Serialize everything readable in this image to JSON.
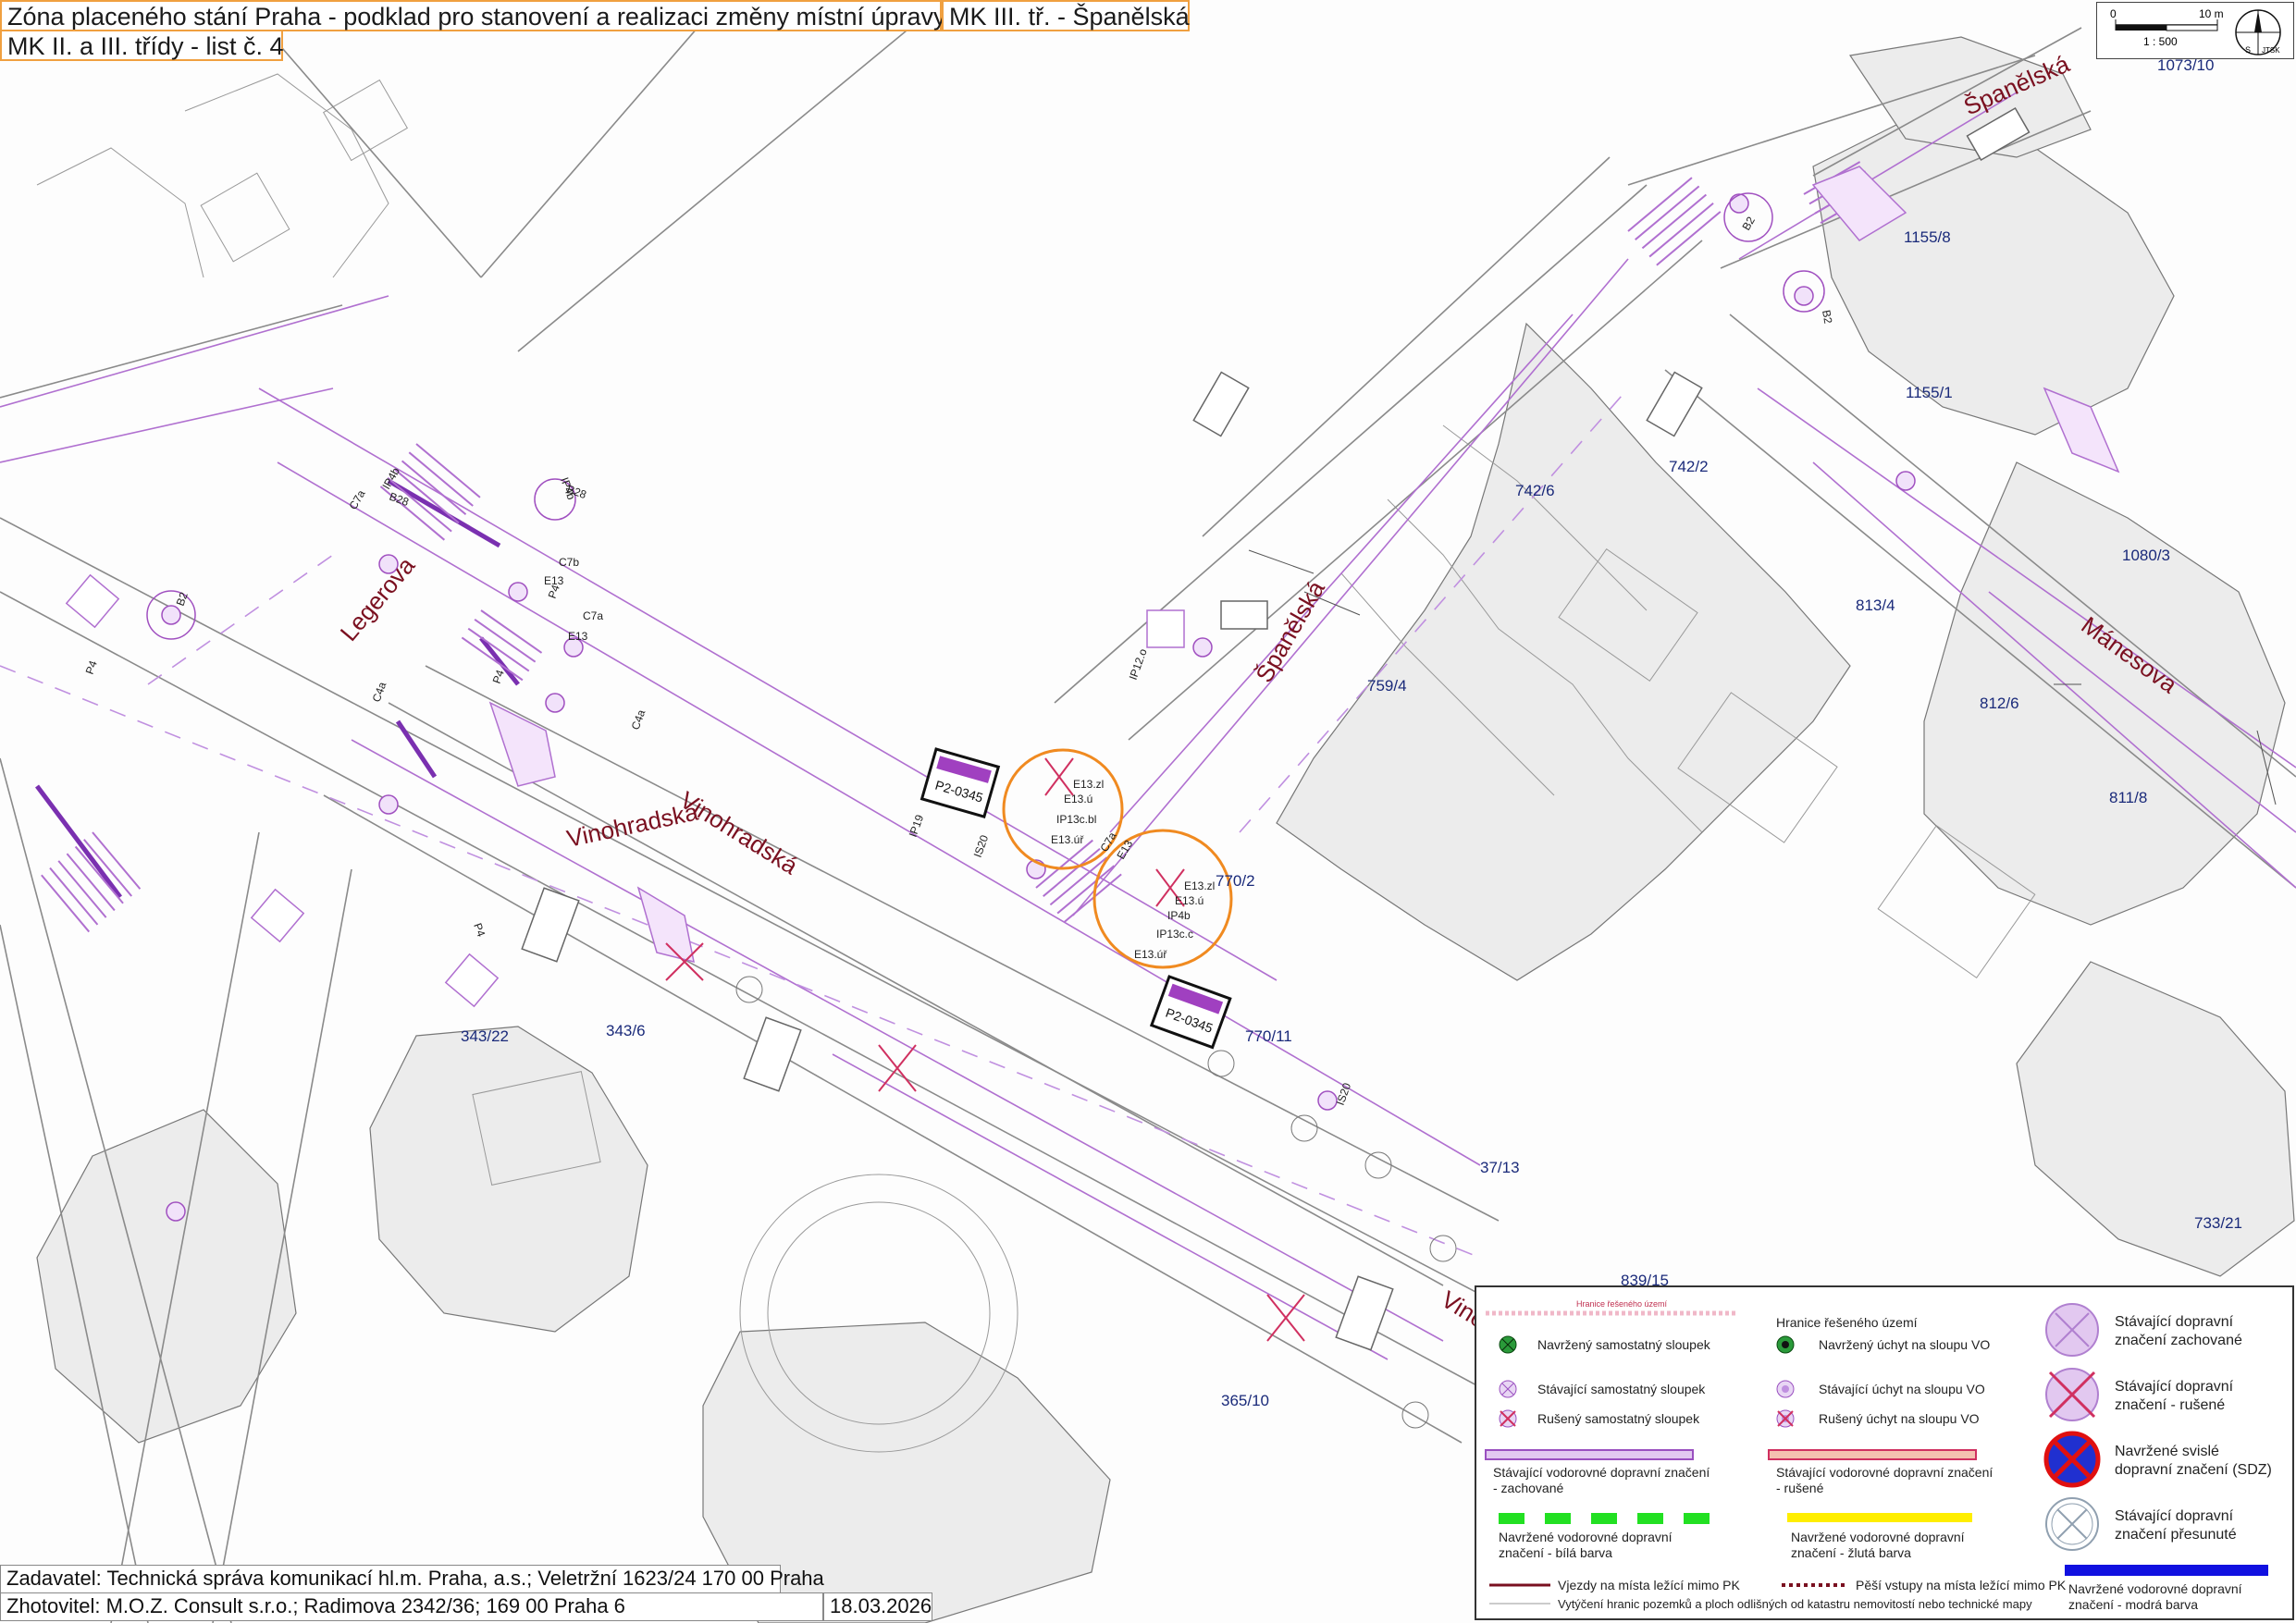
{
  "header": {
    "title": "Zóna placeného stání Praha - podklad pro stanovení a realizaci změny místní úpravy",
    "street": "MK III. tř. - Španělská",
    "sheet": "MK II. a III. třídy - list č. 4"
  },
  "footer": {
    "client": "Zadavatel: Technická správa komunikací hl.m. Praha, a.s.; Veletržní 1623/24 170 00 Praha",
    "contractor": "Zhotovitel: M.O.Z. Consult s.r.o.; Radimova 2342/36; 169 00 Praha 6",
    "date": "18.03.2026"
  },
  "scale": {
    "zero": "0",
    "ten": "10 m",
    "ratio": "1 : 500",
    "north": "S",
    "system": "JTSK"
  },
  "streets": {
    "vinohradska": "Vinohradská",
    "spanelska": "Španělská",
    "legerova": "Legerova",
    "manesova": "Mánesova",
    "vino_short": "Vino"
  },
  "parcels": {
    "p1073_10": "1073/10",
    "p1155_8": "1155/8",
    "p1155_1": "1155/1",
    "p742_6": "742/6",
    "p742_2": "742/2",
    "p1080_3": "1080/3",
    "p813_4": "813/4",
    "p759_4": "759/4",
    "p812_6": "812/6",
    "p811_8": "811/8",
    "p770_2": "770/2",
    "p770_11": "770/11",
    "p343_22": "343/22",
    "p343_6": "343/6",
    "p37_13": "37/13",
    "p839_15": "839/15",
    "p733_21": "733/21",
    "p365_10": "365/10"
  },
  "signs": {
    "pz": "P2-0345",
    "e13zl": "E13.zl",
    "e13u": "E13.ú",
    "ip13cbl": "IP13c.bl",
    "e13ur": "E13.úř",
    "ip4b": "IP4b",
    "ip13cc": "IP13c.c",
    "c7a": "C7a",
    "c7b": "C7b",
    "ip19": "IP19",
    "is20": "IS20",
    "ip12o": "IP12.o",
    "b28": "B28",
    "e13": "E13",
    "b2": "B2",
    "p4": "P4",
    "c4a": "C4a"
  },
  "legend": {
    "boundary_line": "Hranice řešeného území",
    "boundary": "Hranice řešeného území",
    "new_post": "Navržený samostatný sloupek",
    "exist_post": "Stávající samostatný sloupek",
    "cancel_post": "Rušený samostatný sloupek",
    "new_mount": "Navržený úchyt na sloupu VO",
    "exist_mount": "Stávající úchyt na sloupu VO",
    "cancel_mount": "Rušený úchyt na sloupu VO",
    "exist_sign": "Stávající dopravní značení zachované",
    "cancel_sign": "Stávající dopravní značení - rušené",
    "new_sdz": "Navržené svislé dopravní značení (SDZ)",
    "moved_sign": "Stávající dopravní značení přesunuté",
    "exist_hmark": "Stávající vodorovné dopravní značení - zachované",
    "cancel_hmark": "Stávající vodorovné dopravní značení - rušené",
    "new_white": "Navržené vodorovné dopravní značení - bílá barva",
    "new_yellow": "Navržené vodorovné dopravní značení - žlutá barva",
    "new_blue": "Navržené vodorovné dopravní značení - modrá barva",
    "entrances": "Vjezdy na místa ležící mimo PK",
    "ped": "Pěší vstupy na místa ležící mimo PK",
    "plots": "Vytýčení hranic pozemků a ploch odlišných od katastru nemovitostí nebo technické mapy"
  },
  "colors": {
    "accent": "#f0a040",
    "sign_purple": "#a040c0",
    "cancel_red": "#c0305a",
    "street_label": "#7a1020",
    "parcel_label": "#1a2a7a",
    "new_green": "#22e022",
    "new_yellow": "#ffee00",
    "new_blue": "#1010e0"
  }
}
